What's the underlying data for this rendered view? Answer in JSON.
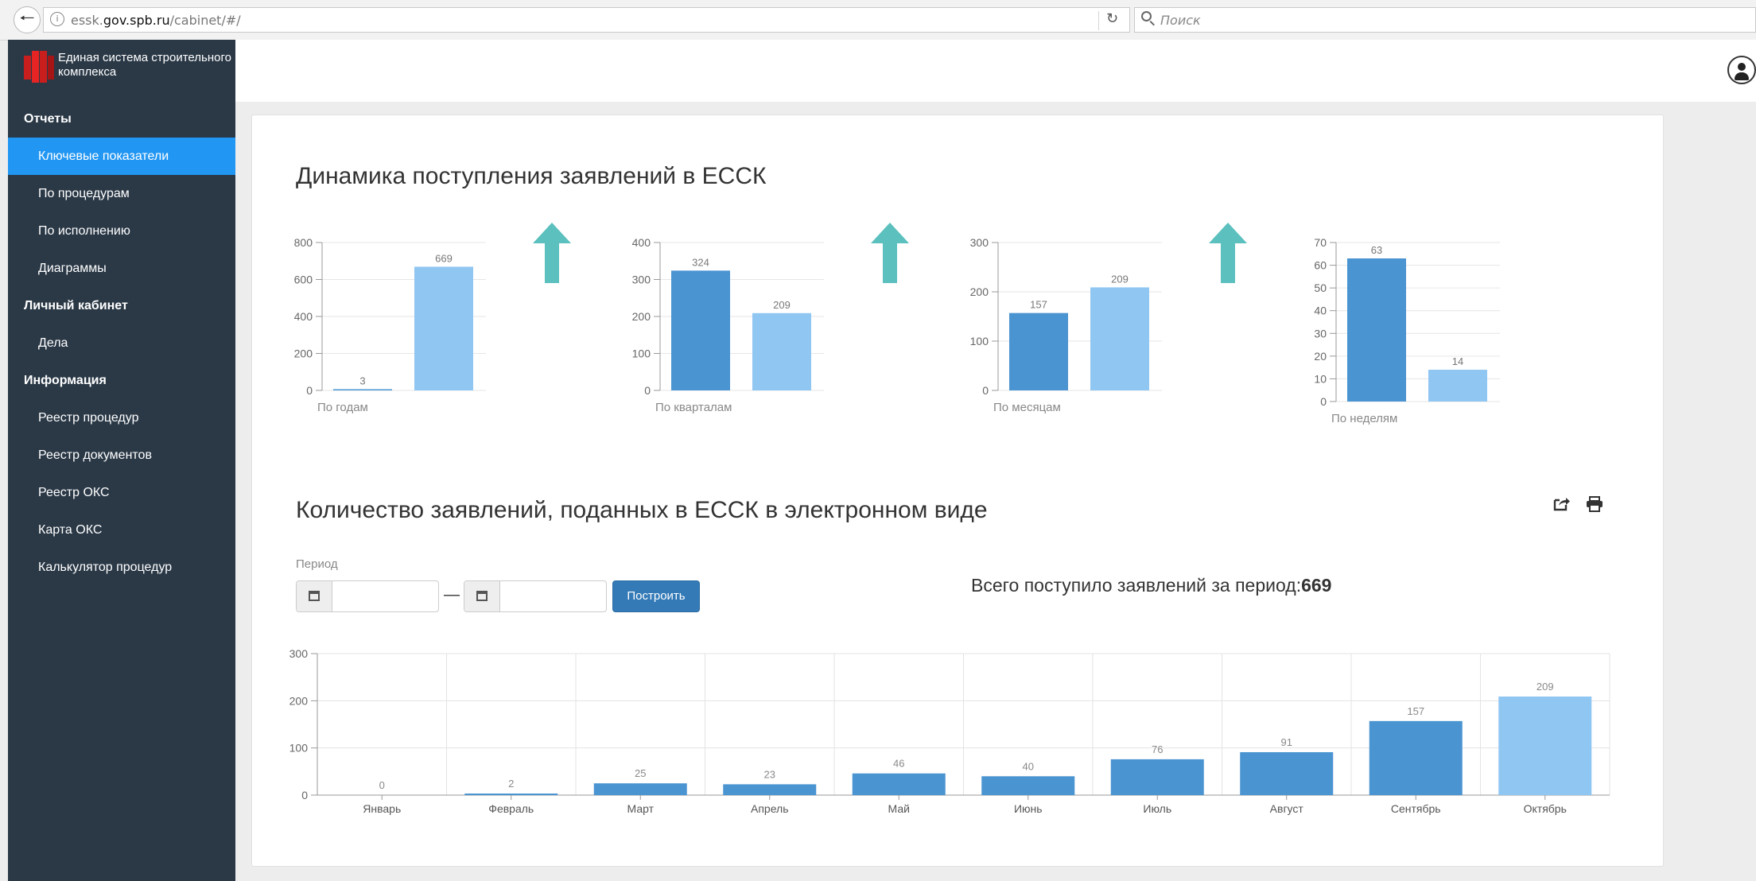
{
  "browser": {
    "url_prefix": "essk.",
    "url_host": "gov.spb.ru",
    "url_path": "/cabinet/#/",
    "search_placeholder": "Поиск"
  },
  "sidebar": {
    "logo_text": "Единая система строительного комплекса",
    "sections": [
      {
        "title": "Отчеты",
        "items": [
          {
            "label": "Ключевые показатели",
            "active": true
          },
          {
            "label": "По процедурам"
          },
          {
            "label": "По исполнению"
          },
          {
            "label": "Диаграммы"
          }
        ]
      },
      {
        "title": "Личный кабинет",
        "items": [
          {
            "label": "Дела"
          }
        ]
      },
      {
        "title": "Информация",
        "items": [
          {
            "label": "Реестр процедур"
          },
          {
            "label": "Реестр документов"
          },
          {
            "label": "Реестр ОКС"
          },
          {
            "label": "Карта ОКС"
          },
          {
            "label": "Калькулятор процедур"
          }
        ]
      }
    ]
  },
  "dynamics": {
    "title": "Динамика поступления заявлений в ЕССК"
  },
  "applications": {
    "title": "Количество заявлений, поданных в ЕССК в электронном виде",
    "period_label": "Период",
    "build_label": "Построить",
    "total_label": "Всего поступило заявлений за период:",
    "total_value": "669"
  },
  "colors": {
    "bar_dark": "#4a94d1",
    "bar_light": "#90c6f2",
    "arrow": "#5bc0be",
    "sidebar_bg": "#2b3947",
    "active_item": "#2196f3",
    "button": "#337ab7"
  },
  "chart_data": [
    {
      "type": "bar",
      "categories": [
        "",
        ""
      ],
      "values": [
        3,
        669
      ],
      "xlabel": "По годам",
      "ylim": [
        0,
        800
      ],
      "yticks": [
        0,
        200,
        400,
        600,
        800
      ],
      "trend": "up"
    },
    {
      "type": "bar",
      "categories": [
        "",
        ""
      ],
      "values": [
        324,
        209
      ],
      "xlabel": "По кварталам",
      "ylim": [
        0,
        400
      ],
      "yticks": [
        0,
        100,
        200,
        300,
        400
      ],
      "trend": "up"
    },
    {
      "type": "bar",
      "categories": [
        "",
        ""
      ],
      "values": [
        157,
        209
      ],
      "xlabel": "По месяцам",
      "ylim": [
        0,
        300
      ],
      "yticks": [
        0,
        100,
        200,
        300
      ],
      "trend": "up"
    },
    {
      "type": "bar",
      "categories": [
        "",
        ""
      ],
      "values": [
        63,
        14
      ],
      "xlabel": "По неделям",
      "ylim": [
        0,
        70
      ],
      "yticks": [
        0,
        10,
        20,
        30,
        40,
        50,
        60,
        70
      ]
    },
    {
      "type": "bar",
      "categories": [
        "Январь",
        "Февраль",
        "Март",
        "Апрель",
        "Май",
        "Июнь",
        "Июль",
        "Август",
        "Сентябрь",
        "Октябрь"
      ],
      "values": [
        0,
        2,
        25,
        23,
        46,
        40,
        76,
        91,
        157,
        209
      ],
      "ylim": [
        0,
        300
      ],
      "yticks": [
        0,
        100,
        200,
        300
      ],
      "grid": true
    }
  ]
}
